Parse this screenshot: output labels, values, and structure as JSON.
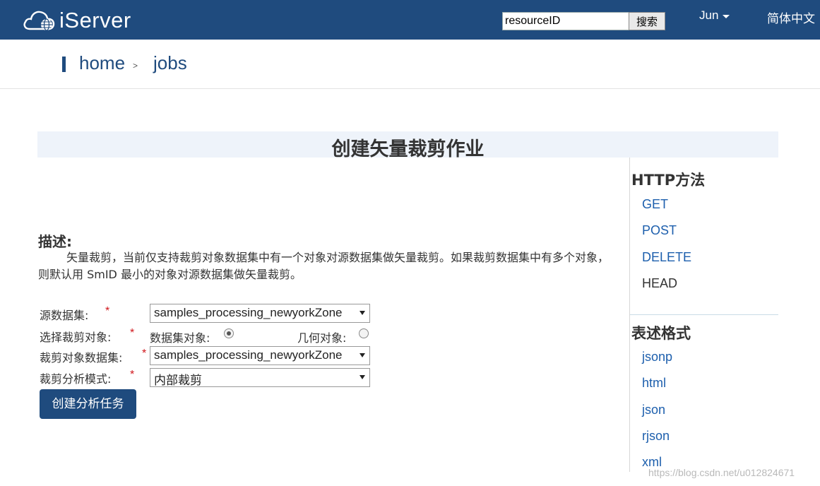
{
  "header": {
    "logo_text": "iServer",
    "search_value": "resourceID",
    "search_button": "搜索",
    "user": "Jun",
    "language": "简体中文"
  },
  "breadcrumb": {
    "home": "home",
    "separator": ">",
    "current": "jobs"
  },
  "main": {
    "title": "创建矢量裁剪作业",
    "description_heading": "描述:",
    "description": "矢量裁剪，当前仅支持裁剪对象数据集中有一个对象对源数据集做矢量裁剪。如果裁剪数据集中有多个对象，则默认用 SmID 最小的对象对源数据集做矢量裁剪。"
  },
  "form": {
    "required_mark": "*",
    "source_label": "源数据集:",
    "source_value": "samples_processing_newyorkZone",
    "clip_object_label": "选择裁剪对象:",
    "option_dataset": "数据集对象:",
    "option_geometry": "几何对象:",
    "clip_dataset_label": "裁剪对象数据集:",
    "clip_dataset_value": "samples_processing_newyorkZone",
    "mode_label": "裁剪分析模式:",
    "mode_value": "内部裁剪",
    "submit": "创建分析任务"
  },
  "sidebar": {
    "methods_heading": "HTTP方法",
    "methods": [
      "GET",
      "POST",
      "DELETE",
      "HEAD"
    ],
    "formats_heading": "表述格式",
    "formats": [
      "jsonp",
      "html",
      "json",
      "rjson",
      "xml"
    ]
  },
  "watermark": "https://blog.csdn.net/u012824671",
  "colors": {
    "header_bg": "#1f4b7e",
    "link": "#1d5fad",
    "required": "#d0161b"
  }
}
